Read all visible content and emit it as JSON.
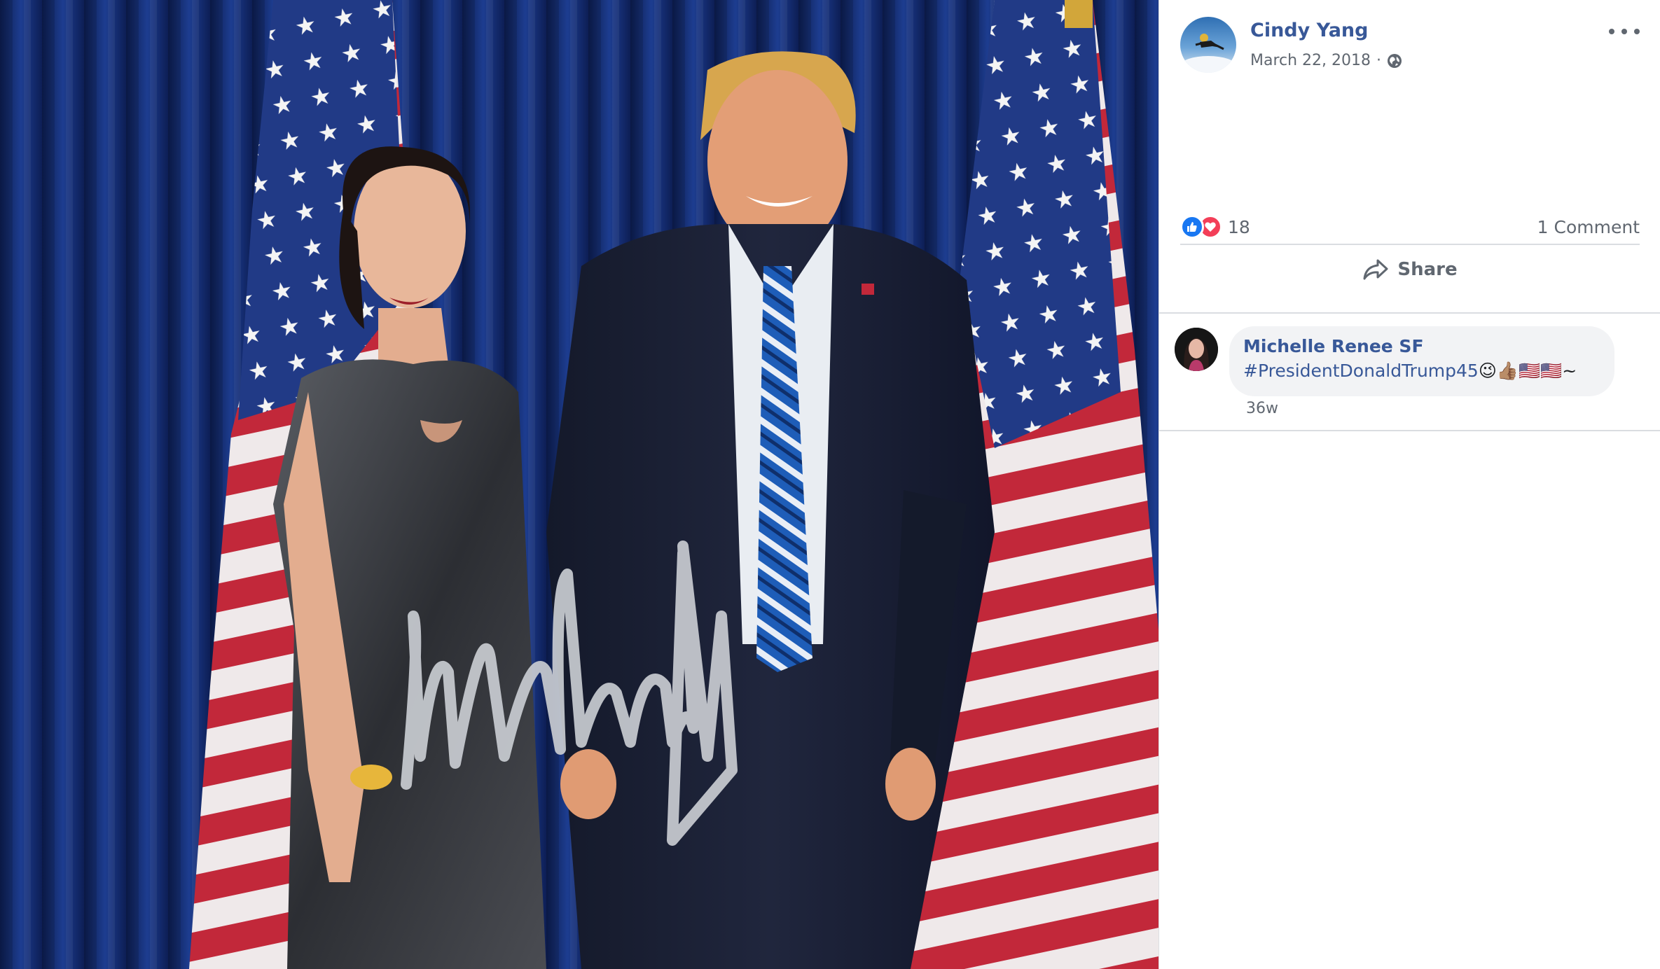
{
  "post": {
    "author_name": "Cindy Yang",
    "date": "March 22, 2018",
    "meta_separator": "·",
    "privacy_icon": "globe-icon",
    "more_icon": "ellipsis-icon",
    "photo": {
      "description_icon": "photo",
      "signature": "Donald Trump autograph"
    }
  },
  "reactions": {
    "types": [
      "like",
      "love"
    ],
    "count": "18",
    "comments_label": "1 Comment"
  },
  "actions": {
    "share_label": "Share",
    "share_icon": "share-arrow-icon"
  },
  "comments": [
    {
      "name": "Michelle Renee SF",
      "hashtag": "#PresidentDonaldTrump45",
      "emojis": "😉👍🏽🇺🇸🇺🇸~",
      "time": "36w"
    }
  ],
  "colors": {
    "link_blue": "#385898",
    "meta_gray": "#606770",
    "like_blue": "#1877f2",
    "love_red": "#f33e58",
    "comment_bubble": "#f2f3f5",
    "divider": "#dadde1"
  }
}
